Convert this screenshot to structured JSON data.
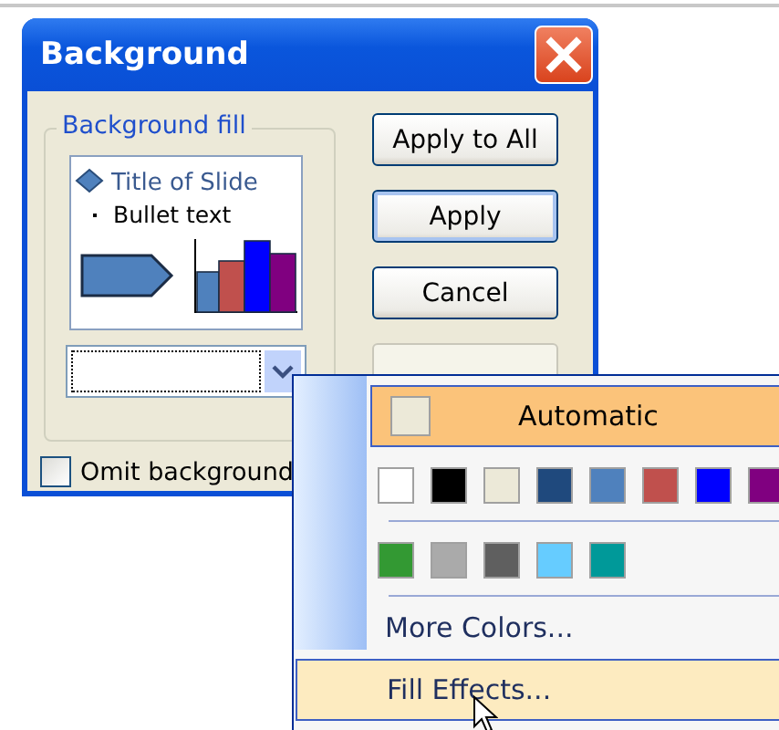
{
  "window": {
    "title": "Background"
  },
  "group": {
    "label": "Background fill"
  },
  "preview": {
    "title": "Title of Slide",
    "bullet": "Bullet text"
  },
  "omit_checkbox": {
    "label": "Omit background",
    "checked": false
  },
  "buttons": [
    {
      "label": "Apply to All",
      "disabled": false,
      "default": false
    },
    {
      "label": "Apply",
      "disabled": false,
      "default": true
    },
    {
      "label": "Cancel",
      "disabled": false,
      "default": false
    },
    {
      "disabled": true,
      "default": false
    }
  ],
  "menu": {
    "automatic": {
      "label": "Automatic",
      "selected": true
    },
    "swatch_rows": [
      [
        {
          "color": "#ffffff"
        },
        {
          "color": "#000000"
        },
        {
          "color": "#ece9d8"
        },
        {
          "color": "#1f497d"
        },
        {
          "color": "#4f81bd"
        },
        {
          "color": "#c0504d"
        },
        {
          "color": "#0000ff"
        },
        {
          "color": "#800080"
        }
      ],
      [
        {
          "color": "#339933"
        },
        {
          "color": "#aaaaaa"
        },
        {
          "color": "#5f5f5f"
        },
        {
          "color": "#66ccff"
        },
        {
          "color": "#009999"
        }
      ]
    ],
    "items": [
      {
        "label": "More Colors...",
        "highlighted": false
      },
      {
        "label": "Fill Effects...",
        "highlighted": true
      }
    ]
  }
}
